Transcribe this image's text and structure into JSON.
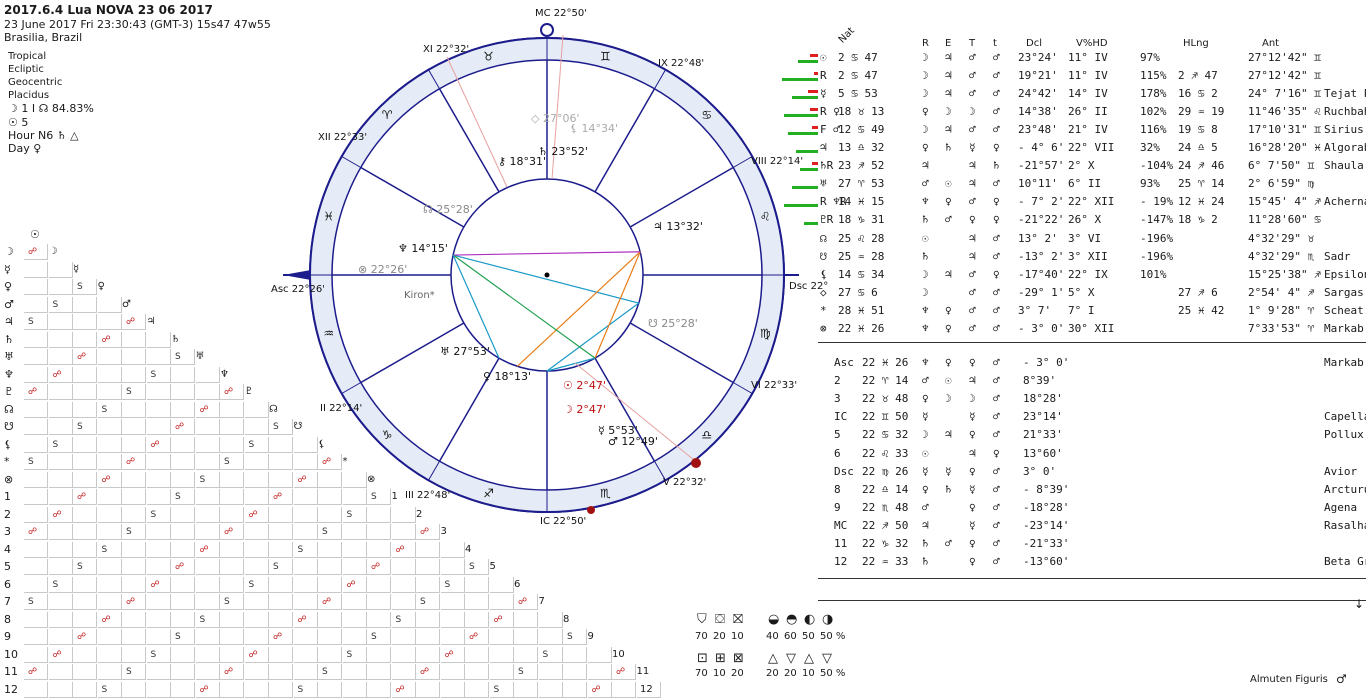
{
  "header": {
    "title": "2017.6.4 Lua NOVA 23 06 2017",
    "datetime": "23 June 2017 Fri  23:30:43 (GMT-3) 15s47  47w55",
    "location": "Brasilia, Brazil"
  },
  "settings": [
    "Tropical",
    "Ecliptic",
    "Geocentric",
    "Placidus"
  ],
  "info": {
    "moon_line": "☽  1 I  ☊ 84.83%",
    "sun_line": "☉  5",
    "hour_line": "Hour N6  ♄  △",
    "day_line": "Day  ♀"
  },
  "wheel": {
    "labels": [
      {
        "t": "MC",
        "v": "22°50'"
      },
      {
        "t": "XI",
        "v": "22°32'"
      },
      {
        "t": "IX",
        "v": "22°48'"
      },
      {
        "t": "XII",
        "v": "22°33'"
      },
      {
        "t": "VIII",
        "v": "22°14'"
      },
      {
        "t": "Asc",
        "v": "22°26'"
      },
      {
        "t": "Dsc",
        "v": "22°26'"
      },
      {
        "t": "II",
        "v": "22°14'"
      },
      {
        "t": "VI",
        "v": "22°33'"
      },
      {
        "t": "III",
        "v": "22°48'"
      },
      {
        "t": "V",
        "v": "22°32'"
      },
      {
        "t": "IC",
        "v": "22°50'"
      }
    ],
    "planets": [
      {
        "g": "♃",
        "v": "13°32'"
      },
      {
        "g": "♅",
        "v": "27°53'"
      },
      {
        "g": "♀",
        "v": "18°13'"
      },
      {
        "g": "☉",
        "v": "2°47'"
      },
      {
        "g": "☽",
        "v": "2°47'"
      },
      {
        "g": "☿",
        "v": "5°53'"
      },
      {
        "g": "♂",
        "v": "12°49'"
      },
      {
        "g": "♆",
        "v": "14°15'"
      },
      {
        "g": "♄",
        "v": "23°52'"
      },
      {
        "g": "⚷",
        "v": "18°31'"
      },
      {
        "g": "☊",
        "v": "25°28'"
      },
      {
        "g": "☋",
        "v": "25°28'"
      },
      {
        "g": "⊗",
        "v": "22°26'"
      },
      {
        "g": "◇",
        "v": "27°06'"
      },
      {
        "g": "⚸",
        "v": "14°34'"
      }
    ],
    "kiron_label": "Kiron"
  },
  "table": {
    "columns": [
      "Nat",
      "R",
      "E",
      "T",
      "t",
      "Dcl",
      "V%HD",
      "HLng",
      "Ant"
    ],
    "rows": [
      {
        "p": "☉",
        "pos": "2 ♋ 47",
        "r": "☽",
        "e": "♃",
        "t": "♂",
        "tt": "♂",
        "dcl": "23°24'",
        "v": "11° IV",
        "hd": "97%",
        "hl": "",
        "ant": "27°12'42\" ♊",
        "star": ""
      },
      {
        "p": "R",
        "pos": "2 ♋ 47",
        "r": "☽",
        "e": "♃",
        "t": "♂",
        "tt": "♂",
        "dcl": "19°21'",
        "v": "11° IV",
        "hd": "115%",
        "hl": "2 ♐ 47",
        "ant": "27°12'42\" ♊",
        "star": ""
      },
      {
        "p": "☿",
        "pos": "5 ♋ 53",
        "r": "☽",
        "e": "♃",
        "t": "♂",
        "tt": "♂",
        "dcl": "24°42'",
        "v": "14° IV",
        "hd": "178%",
        "hl": "16 ♋ 2",
        "ant": "24° 7'16\" ♊",
        "star": "Tejat Post"
      },
      {
        "p": "R ♀",
        "pos": "18 ♉ 13",
        "r": "♀",
        "e": "☽",
        "t": "☽",
        "tt": "♂",
        "dcl": "14°38'",
        "v": "26° II",
        "hd": "102%",
        "hl": "29 ♒ 19",
        "ant": "11°46'35\" ♌",
        "star": "Ruchbah"
      },
      {
        "p": "F ♂",
        "pos": "12 ♋ 49",
        "r": "☽",
        "e": "♃",
        "t": "♂",
        "tt": "♂",
        "dcl": "23°48'",
        "v": "21° IV",
        "hd": "116%",
        "hl": "19 ♋ 8",
        "ant": "17°10'31\" ♊",
        "star": "Sirius"
      },
      {
        "p": "♃",
        "pos": "13 ♎ 32",
        "r": "♀",
        "e": "♄",
        "t": "☿",
        "tt": "♀",
        "dcl": "- 4° 6'",
        "v": "22° VII",
        "hd": "32%",
        "hl": "24 ♎ 5",
        "ant": "16°28'20\" ♓",
        "star": "Algorab"
      },
      {
        "p": "♄R",
        "pos": "23 ♐ 52",
        "r": "♃",
        "e": "",
        "t": "♃",
        "tt": "♄",
        "dcl": "-21°57'",
        "v": "2° X",
        "hd": "-104%",
        "hl": "24 ♐ 46",
        "ant": "6° 7'50\" ♊",
        "star": "Shaula"
      },
      {
        "p": "♅",
        "pos": "27 ♈ 53",
        "r": "♂",
        "e": "☉",
        "t": "♃",
        "tt": "♂",
        "dcl": "10°11'",
        "v": "6° II",
        "hd": "93%",
        "hl": "25 ♈ 14",
        "ant": "2° 6'59\" ♍",
        "star": ""
      },
      {
        "p": "R ♆R",
        "pos": "14 ♓ 15",
        "r": "♆",
        "e": "♀",
        "t": "♂",
        "tt": "♀",
        "dcl": "- 7° 2'",
        "v": "22° XII",
        "hd": "- 19%",
        "hl": "12 ♓ 24",
        "ant": "15°45' 4\" ♐",
        "star": "Achernar"
      },
      {
        "p": "♇R",
        "pos": "18 ♑ 31",
        "r": "♄",
        "e": "♂",
        "t": "♀",
        "tt": "♀",
        "dcl": "-21°22'",
        "v": "26° X",
        "hd": "-147%",
        "hl": "18 ♑ 2",
        "ant": "11°28'60\" ♋",
        "star": ""
      },
      {
        "p": "☊",
        "pos": "25 ♌ 28",
        "r": "☉",
        "e": "",
        "t": "♃",
        "tt": "♂",
        "dcl": "13° 2'",
        "v": "3° VI",
        "hd": "-196%",
        "hl": "",
        "ant": "4°32'29\" ♉",
        "star": ""
      },
      {
        "p": "☋",
        "pos": "25 ♒ 28",
        "r": "♄",
        "e": "",
        "t": "♃",
        "tt": "♂",
        "dcl": "-13° 2'",
        "v": "3° XII",
        "hd": "-196%",
        "hl": "",
        "ant": "4°32'29\" ♏",
        "star": "Sadr"
      },
      {
        "p": "⚸",
        "pos": "14 ♋ 34",
        "r": "☽",
        "e": "♃",
        "t": "♂",
        "tt": "♀",
        "dcl": "-17°40'",
        "v": "22° IX",
        "hd": "101%",
        "hl": "",
        "ant": "15°25'38\" ♐",
        "star": "Epsilon Sgr"
      },
      {
        "p": "◇",
        "pos": "27 ♋ 6",
        "r": "☽",
        "e": "",
        "t": "♂",
        "tt": "♂",
        "dcl": "-29° 1'",
        "v": "5° X",
        "hd": "",
        "hl": "27 ♐ 6",
        "ant": "2°54' 4\" ♐",
        "star": "Sargas"
      },
      {
        "p": "*",
        "pos": "28 ♓ 51",
        "r": "♆",
        "e": "♀",
        "t": "♂",
        "tt": "♂",
        "dcl": "3° 7'",
        "v": "7° I",
        "hd": "",
        "hl": "25 ♓ 42",
        "ant": "1° 9'28\" ♈",
        "star": "Scheat"
      },
      {
        "p": "⊗",
        "pos": "22 ♓ 26",
        "r": "♆",
        "e": "♀",
        "t": "♂",
        "tt": "♂",
        "dcl": "- 3° 0'",
        "v": "30° XII",
        "hd": "",
        "hl": "",
        "ant": "7°33'53\" ♈",
        "star": "Markab"
      }
    ]
  },
  "houses": [
    {
      "h": "Asc",
      "pos": "22 ♓ 26",
      "a": "♆",
      "b": "♀",
      "c": "♀",
      "d": "♂",
      "dcl": "- 3° 0'",
      "star": "Markab"
    },
    {
      "h": "2",
      "pos": "22 ♈ 14",
      "a": "♂",
      "b": "☉",
      "c": "♃",
      "d": "♂",
      "dcl": "8°39'",
      "star": ""
    },
    {
      "h": "3",
      "pos": "22 ♉ 48",
      "a": "♀",
      "b": "☽",
      "c": "☽",
      "d": "♂",
      "dcl": "18°28'",
      "star": ""
    },
    {
      "h": "IC",
      "pos": "22 ♊ 50",
      "a": "☿",
      "b": "",
      "c": "☿",
      "d": "♂",
      "dcl": "23°14'",
      "star": "Capella"
    },
    {
      "h": "5",
      "pos": "22 ♋ 32",
      "a": "☽",
      "b": "♃",
      "c": "♀",
      "d": "♂",
      "dcl": "21°33'",
      "star": "Pollux"
    },
    {
      "h": "6",
      "pos": "22 ♌ 33",
      "a": "☉",
      "b": "",
      "c": "♃",
      "d": "♀",
      "dcl": "13°60'",
      "star": ""
    },
    {
      "h": "Dsc",
      "pos": "22 ♍ 26",
      "a": "☿",
      "b": "☿",
      "c": "♀",
      "d": "♂",
      "dcl": "3° 0'",
      "star": "Avior"
    },
    {
      "h": "8",
      "pos": "22 ♎ 14",
      "a": "♀",
      "b": "♄",
      "c": "☿",
      "d": "♂",
      "dcl": "- 8°39'",
      "star": "Arcturus"
    },
    {
      "h": "9",
      "pos": "22 ♏ 48",
      "a": "♂",
      "b": "",
      "c": "♀",
      "d": "♂",
      "dcl": "-18°28'",
      "star": "Agena"
    },
    {
      "h": "MC",
      "pos": "22 ♐ 50",
      "a": "♃",
      "b": "",
      "c": "☿",
      "d": "♂",
      "dcl": "-23°14'",
      "star": "Rasalhague"
    },
    {
      "h": "11",
      "pos": "22 ♑ 32",
      "a": "♄",
      "b": "♂",
      "c": "♀",
      "d": "♂",
      "dcl": "-21°33'",
      "star": ""
    },
    {
      "h": "12",
      "pos": "22 ♒ 33",
      "a": "♄",
      "b": "",
      "c": "♀",
      "d": "♂",
      "dcl": "-13°60'",
      "star": "Beta Gru"
    }
  ],
  "grid": {
    "row_labels": [
      "☽",
      "☿",
      "♀",
      "♂",
      "♃",
      "♄",
      "♅",
      "♆",
      "♇",
      "☊",
      "☋",
      "⚸",
      "*",
      "⊗",
      "1",
      "2",
      "3",
      "4",
      "5",
      "6",
      "7",
      "8",
      "9",
      "10",
      "11",
      "12"
    ],
    "top_glyph": "☉"
  },
  "bottom_stats": {
    "group1_values": [
      "70",
      "20",
      "10"
    ],
    "group2_values": [
      "40",
      "60",
      "50",
      "50 %"
    ],
    "group3_values": [
      "70",
      "10",
      "20"
    ],
    "group4_values": [
      "20",
      "20",
      "10",
      "50 %"
    ]
  },
  "footer": {
    "almuten_label": "Almuten Figuris",
    "almuten_glyph": "♂"
  },
  "colors": {
    "wheel_line": "#1c1c8c",
    "ring_fill": "#e6ecf7",
    "sextile": "#22a050",
    "trine": "#1a9ac8",
    "square": "#e87d18",
    "opposition": "#c01010",
    "bar_green": "#22b022",
    "bar_red": "#e02020"
  }
}
